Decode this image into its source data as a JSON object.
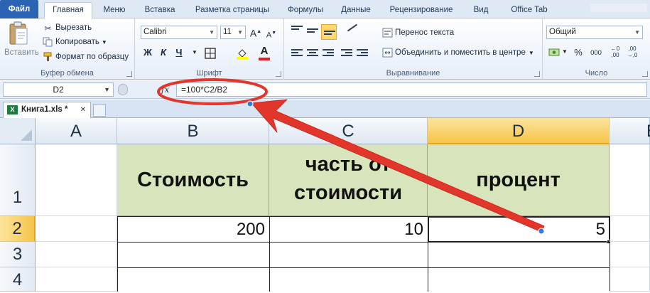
{
  "ribbon_tabs": [
    {
      "label": "Файл"
    },
    {
      "label": "Главная"
    },
    {
      "label": "Меню"
    },
    {
      "label": "Вставка"
    },
    {
      "label": "Разметка страницы"
    },
    {
      "label": "Формулы"
    },
    {
      "label": "Данные"
    },
    {
      "label": "Рецензирование"
    },
    {
      "label": "Вид"
    },
    {
      "label": "Office Tab"
    }
  ],
  "clipboard": {
    "paste": "Вставить",
    "cut": "Вырезать",
    "copy": "Копировать",
    "format_painter": "Формат по образцу",
    "group": "Буфер обмена"
  },
  "font": {
    "name": "Calibri",
    "size": "11",
    "bold": "Ж",
    "italic": "К",
    "underline": "Ч",
    "grow": "A",
    "shrink": "A",
    "font_color": "A",
    "group": "Шрифт"
  },
  "alignment": {
    "wrap_text": "Перенос текста",
    "merge_center": "Объединить и поместить в центре",
    "group": "Выравнивание"
  },
  "number": {
    "format": "Общий",
    "percent": "%",
    "comma": "000",
    "group": "Число"
  },
  "formula_bar": {
    "name_box": "D2",
    "fx": "fx",
    "formula": "=100*C2/B2"
  },
  "workbook_tab": {
    "label": "Книга1.xls *",
    "close": "✕"
  },
  "sheet": {
    "columns": [
      "A",
      "B",
      "C",
      "D",
      "E"
    ],
    "rows": [
      "1",
      "2",
      "3",
      "4"
    ],
    "header_row": {
      "b1": "Стоимость",
      "c1_line1": "часть от",
      "c1_line2": "стоимости",
      "d1": "процент"
    },
    "data_row": {
      "b2": "200",
      "c2": "10",
      "d2": "5"
    },
    "selected_cell": "D2"
  },
  "colors": {
    "header_fill": "#d8e4bc",
    "annotation": "#e2362b",
    "selection_header": "#f6c548"
  }
}
